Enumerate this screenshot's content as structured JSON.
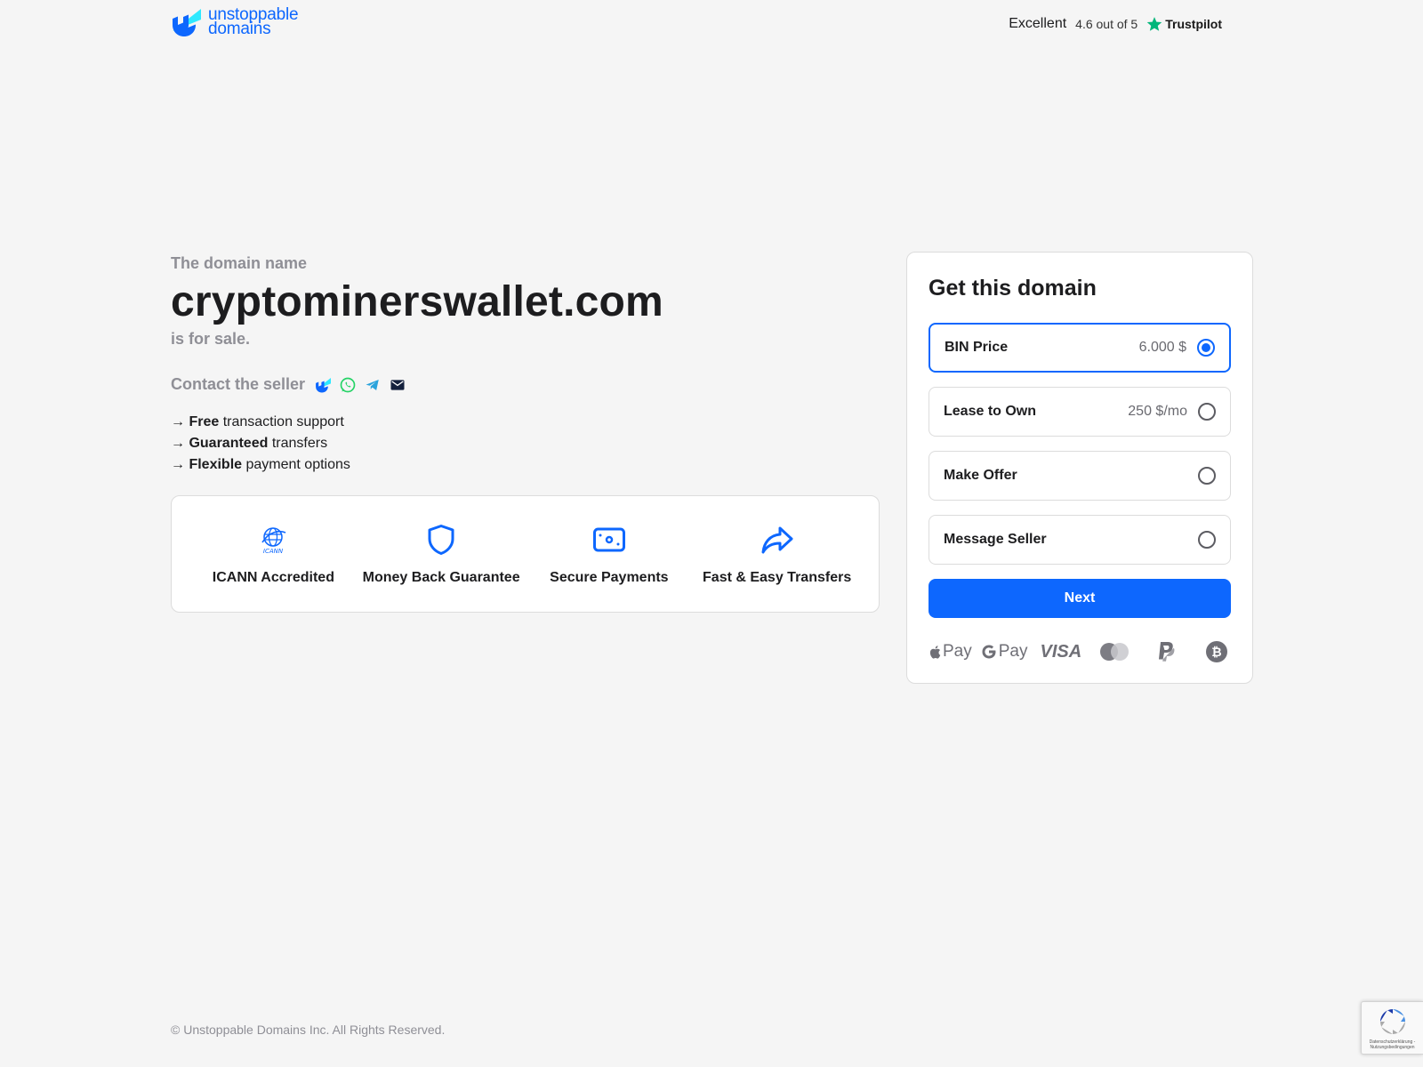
{
  "header": {
    "logo_line1": "unstoppable",
    "logo_line2": "domains",
    "trust_rating": "Excellent",
    "trust_score": "4.6 out of 5",
    "trust_brand": "Trustpilot"
  },
  "main": {
    "kicker": "The domain name",
    "domain": "cryptominerswallet.com",
    "for_sale": "is for sale.",
    "contact_label": "Contact the seller",
    "benefits": [
      {
        "arrow": "→",
        "bold": "Free",
        "rest": " transaction support"
      },
      {
        "arrow": "→",
        "bold": "Guaranteed",
        "rest": " transfers"
      },
      {
        "arrow": "→",
        "bold": "Flexible",
        "rest": " payment options"
      }
    ],
    "features": [
      {
        "label": "ICANN Accredited",
        "icon": "icann-icon"
      },
      {
        "label": "Money Back Guarantee",
        "icon": "shield-icon"
      },
      {
        "label": "Secure Payments",
        "icon": "payment-icon"
      },
      {
        "label": "Fast & Easy Transfers",
        "icon": "share-arrow-icon"
      }
    ]
  },
  "card": {
    "title": "Get this domain",
    "options": [
      {
        "label": "BIN Price",
        "price": "6.000 $",
        "selected": true
      },
      {
        "label": "Lease to Own",
        "price": "250 $/mo",
        "selected": false
      },
      {
        "label": "Make Offer",
        "price": "",
        "selected": false
      },
      {
        "label": "Message Seller",
        "price": "",
        "selected": false
      }
    ],
    "next_label": "Next",
    "payment_methods": {
      "apple_pay": "Pay",
      "google_pay": "Pay",
      "visa": "VISA"
    }
  },
  "footer": {
    "copyright": "© Unstoppable Domains Inc. All Rights Reserved."
  },
  "recaptcha": {
    "text": "Datenschutzerklärung - Nutzungsbedingungen"
  },
  "colors": {
    "accent": "#0d67fe",
    "background": "#f5f5f5",
    "muted": "#8f8f96",
    "trustpilot_star": "#00b67a",
    "whatsapp": "#25d366",
    "telegram": "#2aa3dc"
  }
}
